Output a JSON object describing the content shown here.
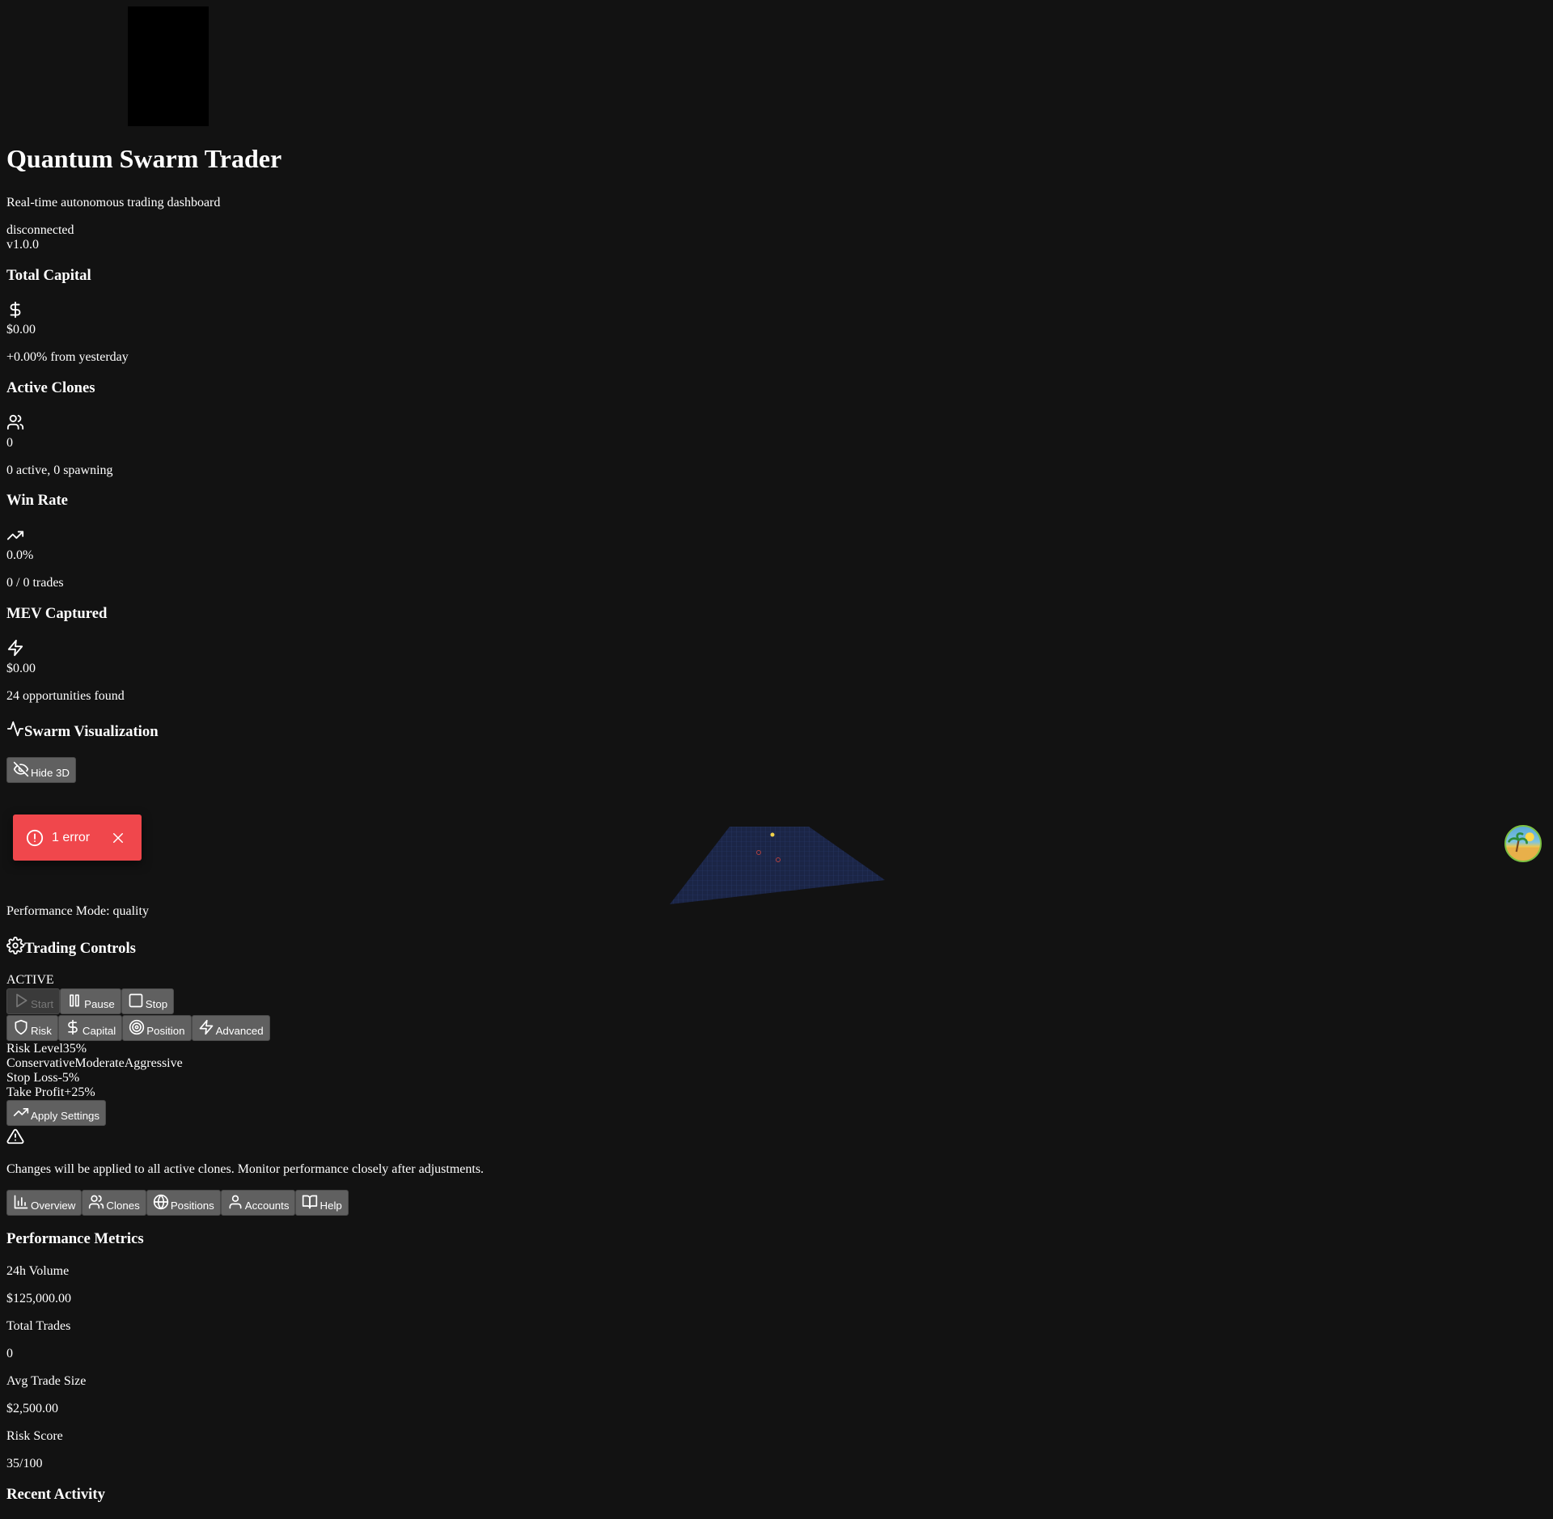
{
  "header": {
    "title": "Quantum Swarm Trader",
    "subtitle": "Real-time autonomous trading dashboard",
    "connection_status": "disconnected",
    "version": "v1.0.0"
  },
  "stats": [
    {
      "title": "Total Capital",
      "icon": "dollar-icon",
      "value": "$0.00",
      "note": "+0.00% from yesterday"
    },
    {
      "title": "Active Clones",
      "icon": "users-icon",
      "value": "0",
      "note": "0 active, 0 spawning"
    },
    {
      "title": "Win Rate",
      "icon": "trending-up-icon",
      "value": "0.0%",
      "note": "0 / 0 trades"
    },
    {
      "title": "MEV Captured",
      "icon": "zap-icon",
      "value": "$0.00",
      "note": "24 opportunities found"
    }
  ],
  "swarm": {
    "title": "Swarm Visualization",
    "toggle_label": "Hide 3D",
    "performance_mode": "Performance Mode: quality"
  },
  "toast": {
    "label": "1 error"
  },
  "controls": {
    "title": "Trading Controls",
    "state": "ACTIVE",
    "start": "Start",
    "pause": "Pause",
    "stop": "Stop",
    "tabs": [
      "Risk",
      "Capital",
      "Position",
      "Advanced"
    ],
    "risk_level_label": "Risk Level",
    "risk_level_value": "35%",
    "risk_presets": [
      "Conservative",
      "Moderate",
      "Aggressive"
    ],
    "stop_loss_label": "Stop Loss",
    "stop_loss_value": "-5%",
    "take_profit_label": "Take Profit",
    "take_profit_value": "+25%",
    "apply": "Apply Settings",
    "warning": "Changes will be applied to all active clones. Monitor performance closely after adjustments."
  },
  "nav_tabs": [
    "Overview",
    "Clones",
    "Positions",
    "Accounts",
    "Help"
  ],
  "metrics": {
    "title": "Performance Metrics",
    "items": [
      {
        "label": "24h Volume",
        "value": "$125,000.00"
      },
      {
        "label": "Total Trades",
        "value": "0"
      },
      {
        "label": "Avg Trade Size",
        "value": "$2,500.00"
      },
      {
        "label": "Risk Score",
        "value": "35/100"
      }
    ]
  },
  "activity": {
    "title": "Recent Activity"
  },
  "colors": {
    "background": "#121212",
    "button": "#606060",
    "toast": "#f0474c",
    "grid": "#1e2d5a"
  }
}
